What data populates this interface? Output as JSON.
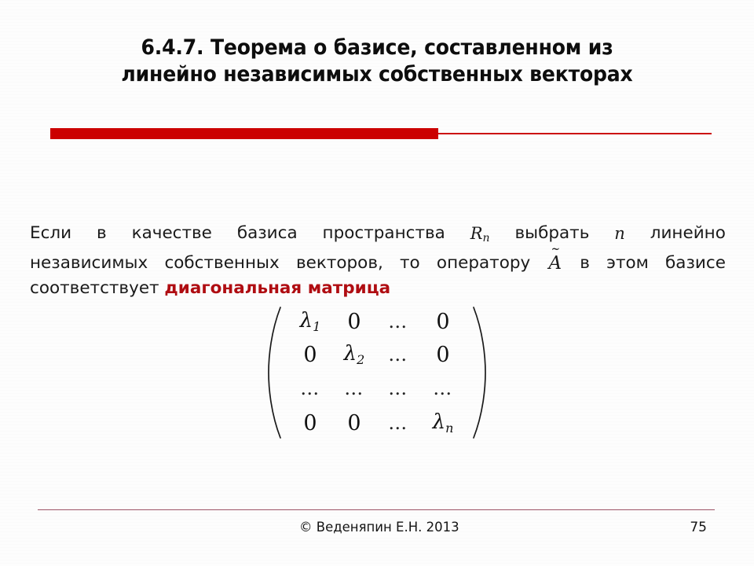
{
  "slide": {
    "title_line1": "6.4.7. Теорема о базисе, составленном из",
    "title_line2": "линейно независимых собственных векторах",
    "accent_color": "#cc0000",
    "rule_color": "#9e5567",
    "emphasis_color": "#b00d12"
  },
  "body": {
    "line1": {
      "w1": "Если",
      "w2": "в",
      "w3": "качестве",
      "w4": "базиса",
      "w5": "пространства",
      "w6": "R",
      "w6sub": "n",
      "w7": "выбрать",
      "w8": "n",
      "w9": "линейно"
    },
    "line2": {
      "w1": "независимых",
      "w2": "собственных",
      "w3": "векторов,",
      "w4": "то",
      "w5": "оператору",
      "w6": "A",
      "w6_accent": "~",
      "w7": "в",
      "w8": "этом",
      "w9": "базисе"
    },
    "line3": {
      "w1": "соответствует",
      "emphasis": "диагональная матрица"
    }
  },
  "matrix": {
    "rows": [
      [
        "λ",
        "1",
        "0",
        "…",
        "0"
      ],
      [
        "0",
        "",
        "λ",
        "2",
        "…",
        "0"
      ],
      [
        "…",
        "…",
        "…",
        "…"
      ],
      [
        "0",
        "0",
        "…",
        "λ",
        "n"
      ]
    ],
    "r1c1_lam": "λ",
    "r1c1_sub": "1",
    "r1c2": "0",
    "r1c3": "…",
    "r1c4": "0",
    "r2c1": "0",
    "r2c2_lam": "λ",
    "r2c2_sub": "2",
    "r2c3": "…",
    "r2c4": "0",
    "r3c1": "…",
    "r3c2": "…",
    "r3c3": "…",
    "r3c4": "…",
    "r4c1": "0",
    "r4c2": "0",
    "r4c3": "…",
    "r4c4_lam": "λ",
    "r4c4_sub": "n"
  },
  "footer": {
    "copyright": "© Веденяпин Е.Н. 2013",
    "page_number": "75"
  }
}
